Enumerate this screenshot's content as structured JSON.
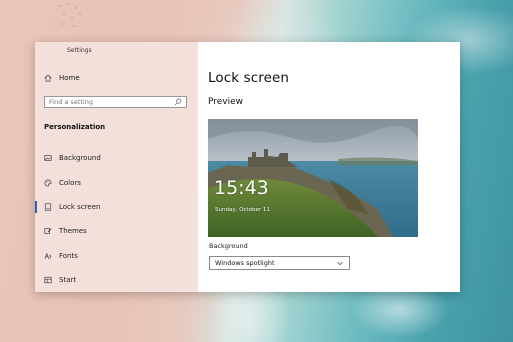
{
  "window": {
    "title": "Settings"
  },
  "sidebar": {
    "home_label": "Home",
    "search_placeholder": "Find a setting",
    "section_label": "Personalization",
    "items": [
      {
        "label": "Background",
        "icon": "picture-icon"
      },
      {
        "label": "Colors",
        "icon": "palette-icon"
      },
      {
        "label": "Lock screen",
        "icon": "lock-screen-icon",
        "active": true
      },
      {
        "label": "Themes",
        "icon": "brush-icon"
      },
      {
        "label": "Fonts",
        "icon": "fonts-icon"
      },
      {
        "label": "Start",
        "icon": "start-menu-icon"
      }
    ]
  },
  "main": {
    "page_title": "Lock screen",
    "preview_heading": "Preview",
    "preview": {
      "time": "15:43",
      "date": "Sunday, October 11"
    },
    "background_label": "Background",
    "background_value": "Windows spotlight"
  },
  "colors": {
    "accent": "#2a5fc9",
    "sidebar_bg": "#f5e4e0",
    "content_bg": "#ffffff"
  }
}
